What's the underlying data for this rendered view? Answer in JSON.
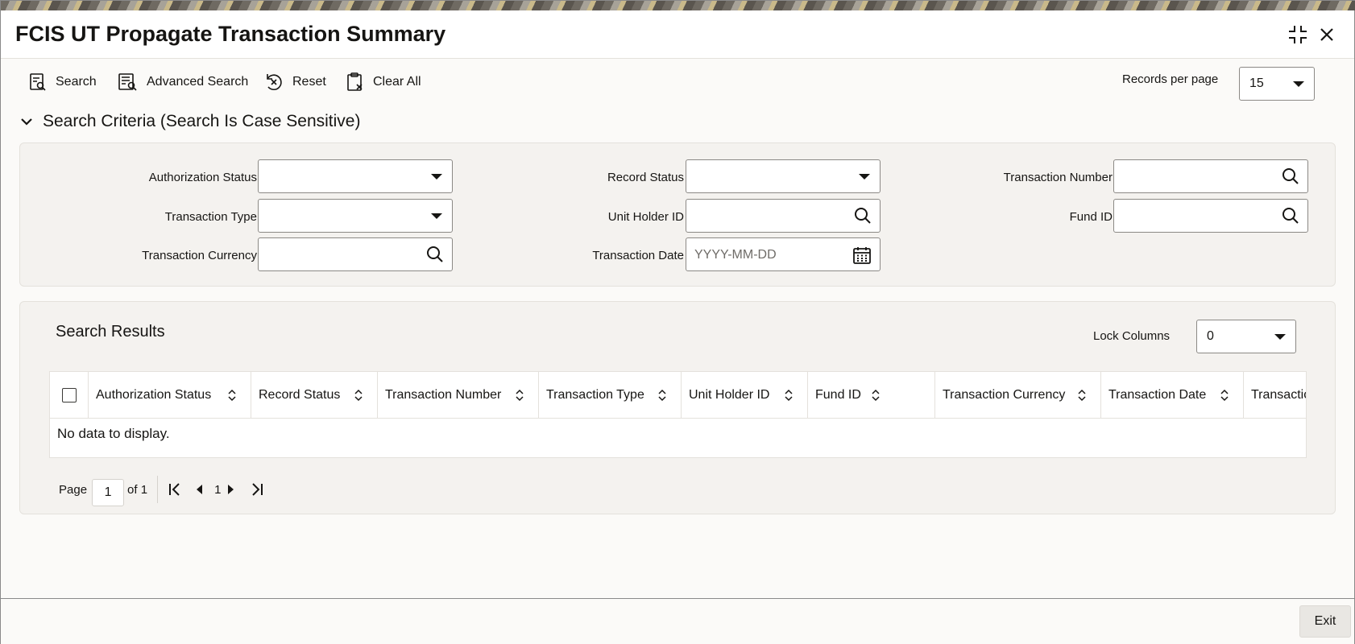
{
  "window": {
    "title": "FCIS UT Propagate Transaction Summary"
  },
  "toolbar": {
    "search_label": "Search",
    "advanced_search_label": "Advanced Search",
    "reset_label": "Reset",
    "clear_all_label": "Clear All",
    "records_per_page_label": "Records per page",
    "records_per_page_value": "15"
  },
  "criteria": {
    "header": "Search Criteria (Search Is Case Sensitive)",
    "authorization_status_label": "Authorization Status",
    "authorization_status_value": "",
    "record_status_label": "Record Status",
    "record_status_value": "",
    "transaction_number_label": "Transaction Number",
    "transaction_number_value": "",
    "transaction_type_label": "Transaction Type",
    "transaction_type_value": "",
    "unit_holder_id_label": "Unit Holder ID",
    "unit_holder_id_value": "",
    "fund_id_label": "Fund ID",
    "fund_id_value": "",
    "transaction_currency_label": "Transaction Currency",
    "transaction_currency_value": "",
    "transaction_date_label": "Transaction Date",
    "transaction_date_placeholder": "YYYY-MM-DD"
  },
  "results": {
    "title": "Search Results",
    "lock_columns_label": "Lock Columns",
    "lock_columns_value": "0",
    "columns": [
      "Authorization Status",
      "Record Status",
      "Transaction Number",
      "Transaction Type",
      "Unit Holder ID",
      "Fund ID",
      "Transaction Currency",
      "Transaction Date",
      "Transactio"
    ],
    "empty_message": "No data to display."
  },
  "pager": {
    "page_label": "Page",
    "current_page": "1",
    "of_label": "of 1",
    "page_number": "1"
  },
  "footer": {
    "exit_label": "Exit"
  },
  "icons": {
    "search": "search-icon",
    "advanced_search": "advanced-search-icon",
    "reset": "reset-icon",
    "clear_all": "clear-all-icon",
    "magnifier": "magnifier-icon",
    "calendar": "calendar-icon",
    "collapse": "chevron-down-icon",
    "maximize": "maximize-icon",
    "close": "close-icon"
  }
}
